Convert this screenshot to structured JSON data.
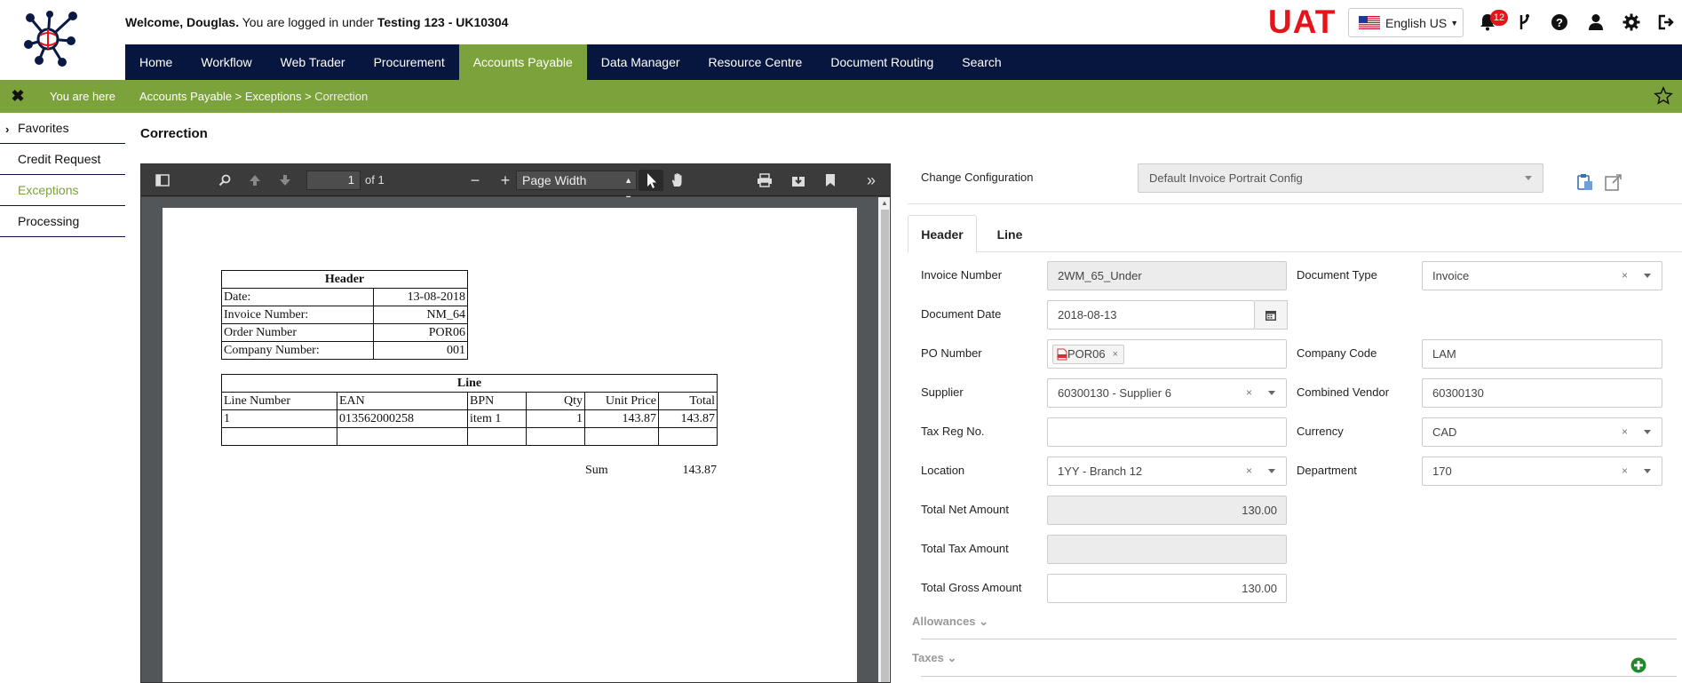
{
  "header": {
    "welcome_prefix": "Welcome, Douglas.",
    "welcome_middle": " You are logged in under ",
    "welcome_org": "Testing 123 - UK10304",
    "env_label": "UAT",
    "language": "English US",
    "notifications_count": "12"
  },
  "nav": {
    "items": [
      "Home",
      "Workflow",
      "Web Trader",
      "Procurement",
      "Accounts Payable",
      "Data Manager",
      "Resource Centre",
      "Document Routing",
      "Search"
    ],
    "active": "Accounts Payable"
  },
  "breadcrumb": {
    "you_are_here": "You are here",
    "path": "Accounts Payable > Exceptions > ",
    "current": "Correction"
  },
  "sidebar": {
    "items": [
      {
        "label": "Favorites"
      },
      {
        "label": "Credit Request"
      },
      {
        "label": "Exceptions"
      },
      {
        "label": "Processing"
      }
    ]
  },
  "page": {
    "title": "Correction"
  },
  "viewer": {
    "page_number": "1",
    "page_of": "of 1",
    "zoom": "Page Width"
  },
  "document": {
    "header_title": "Header",
    "header_rows": [
      {
        "label": "Date:",
        "value": "13-08-2018"
      },
      {
        "label": "Invoice Number:",
        "value": "NM_64"
      },
      {
        "label": "Order Number",
        "value": "POR06"
      },
      {
        "label": "Company Number:",
        "value": "001"
      }
    ],
    "line_title": "Line",
    "line_columns": [
      "Line Number",
      "EAN",
      "BPN",
      "Qty",
      "Unit Price",
      "Total"
    ],
    "line_rows": [
      [
        "1",
        "013562000258",
        "item 1",
        "1",
        "143.87",
        "143.87"
      ]
    ],
    "sum_label": "Sum",
    "sum_value": "143.87"
  },
  "form": {
    "change_config_label": "Change Configuration",
    "change_config_value": "Default Invoice Portrait Config",
    "tabs": [
      "Header",
      "Line"
    ],
    "invoice_number_label": "Invoice Number",
    "invoice_number": "2WM_65_Under",
    "document_type_label": "Document Type",
    "document_type": "Invoice",
    "document_date_label": "Document Date",
    "document_date": "2018-08-13",
    "po_number_label": "PO Number",
    "po_number": "POR06",
    "company_code_label": "Company Code",
    "company_code": "LAM",
    "supplier_label": "Supplier",
    "supplier": "60300130 - Supplier 6",
    "combined_vendor_label": "Combined Vendor",
    "combined_vendor": "60300130",
    "tax_reg_label": "Tax Reg No.",
    "tax_reg": "",
    "currency_label": "Currency",
    "currency": "CAD",
    "location_label": "Location",
    "location": "1YY - Branch 12",
    "department_label": "Department",
    "department": "170",
    "total_net_label": "Total Net Amount",
    "total_net": "130.00",
    "total_tax_label": "Total Tax Amount",
    "total_tax": "",
    "total_gross_label": "Total Gross Amount",
    "total_gross": "130.00",
    "allowances_label": "Allowances",
    "taxes_label": "Taxes"
  }
}
